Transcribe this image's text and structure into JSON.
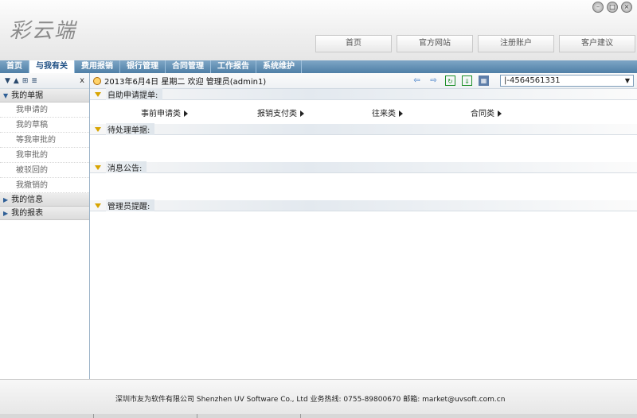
{
  "header": {
    "logo_text": "彩云端",
    "window_controls": [
      "minimize",
      "restore",
      "close"
    ],
    "top_nav": [
      "首页",
      "官方网站",
      "注册账户",
      "客户建议"
    ]
  },
  "tabs": [
    {
      "label": "首页",
      "active": false
    },
    {
      "label": "与我有关",
      "active": true
    },
    {
      "label": "费用报销",
      "active": false
    },
    {
      "label": "银行管理",
      "active": false
    },
    {
      "label": "合同管理",
      "active": false
    },
    {
      "label": "工作报告",
      "active": false
    },
    {
      "label": "系统维护",
      "active": false
    }
  ],
  "sidebar": {
    "close_label": "x",
    "groups": [
      {
        "label": "我的单据",
        "expanded": true,
        "items": [
          "我申请的",
          "我的草稿",
          "等我审批的",
          "我审批的",
          "被驳回的",
          "我撤销的"
        ]
      },
      {
        "label": "我的信息",
        "expanded": false,
        "items": []
      },
      {
        "label": "我的报表",
        "expanded": false,
        "items": []
      }
    ]
  },
  "status": {
    "text": "2013年6月4日 星期二 欢迎 管理员(admin1)",
    "account": "|-4564561331"
  },
  "sections": [
    {
      "title": "自助申请提单:",
      "links": [
        "事前申请类",
        "报销支付类",
        "往来类",
        "合同类"
      ]
    },
    {
      "title": "待处理单据:",
      "links": []
    },
    {
      "title": "消息公告:",
      "links": []
    },
    {
      "title": "管理员提醒:",
      "links": []
    }
  ],
  "footer": {
    "text": "深圳市友为软件有限公司 Shenzhen UV Software Co., Ltd    业务热线: 0755-89800670    邮箱: market@uvsoft.com.cn"
  },
  "colors": {
    "tab_bar": "#5d89b0",
    "active_tab_text": "#1e4f84",
    "section_icon": "#d8a400"
  }
}
